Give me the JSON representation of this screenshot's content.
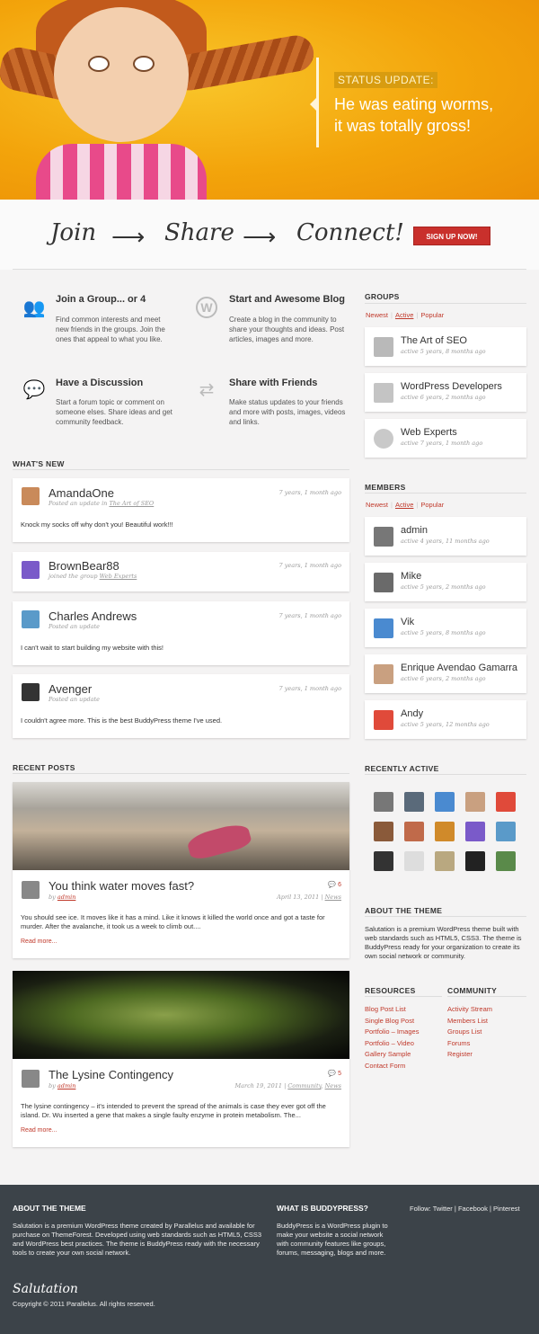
{
  "hero": {
    "status_tag": "STATUS UPDATE:",
    "status_line1": "He was eating worms,",
    "status_line2": "it was totally gross!"
  },
  "join": {
    "step1": "Join",
    "step2": "Share",
    "step3": "Connect!",
    "signup_label": "SIGN UP NOW!"
  },
  "features": [
    {
      "title": "Join a Group... or 4",
      "desc": "Find common interests and meet new friends in the groups. Join the ones that appeal to what you like."
    },
    {
      "title": "Start and Awesome Blog",
      "desc": "Create a blog in the community to share your thoughts and ideas. Post articles, images and more."
    },
    {
      "title": "Have a Discussion",
      "desc": "Start a forum topic or comment on someone elses. Share ideas and get community feedback."
    },
    {
      "title": "Share with Friends",
      "desc": "Make status updates to your friends and more with posts, images, videos and links."
    }
  ],
  "whats_new": {
    "title": "WHAT'S NEW",
    "items": [
      {
        "name": "AmandaOne",
        "time": "7 years, 1 month ago",
        "meta_prefix": "Posted an update in",
        "meta_link": "The Art of SEO",
        "text": "Knock my socks off why don't you! Beautiful work!!!"
      },
      {
        "name": "BrownBear88",
        "time": "7 years, 1 month ago",
        "meta_prefix": "joined the group",
        "meta_link": "Web Experts",
        "text": ""
      },
      {
        "name": "Charles Andrews",
        "time": "7 years, 1 month ago",
        "meta_prefix": "Posted an update",
        "meta_link": "",
        "text": "I can't wait to start building my website with this!"
      },
      {
        "name": "Avenger",
        "time": "7 years, 1 month ago",
        "meta_prefix": "Posted an update",
        "meta_link": "",
        "text": "I couldn't agree more. This is the best BuddyPress theme I've used."
      }
    ]
  },
  "recent_posts": {
    "title": "RECENT POSTS",
    "posts": [
      {
        "title": "You think water moves fast?",
        "by": "by",
        "author": "admin",
        "date": "April 13, 2011",
        "category": "News",
        "comments": "6",
        "excerpt": "You should see ice. It moves like it has a mind. Like it knows it killed the world once and got a taste for murder. After the avalanche, it took us a week to climb out....",
        "read_more": "Read more..."
      },
      {
        "title": "The Lysine Contingency",
        "by": "by",
        "author": "admin",
        "date": "March 19, 2011",
        "category1": "Community",
        "category2": "News",
        "comments": "5",
        "excerpt": "The lysine contingency – it's intended to prevent the spread of the animals is case they ever got off the island. Dr. Wu inserted a gene that makes a single faulty enzyme in protein metabolism. The...",
        "read_more": "Read more..."
      }
    ]
  },
  "groups": {
    "title": "GROUPS",
    "tabs": [
      "Newest",
      "Active",
      "Popular"
    ],
    "items": [
      {
        "name": "The Art of SEO",
        "meta": "active 5 years, 8 months ago"
      },
      {
        "name": "WordPress Developers",
        "meta": "active 6 years, 2 months ago"
      },
      {
        "name": "Web Experts",
        "meta": "active 7 years, 1 month ago"
      }
    ]
  },
  "members": {
    "title": "MEMBERS",
    "tabs": [
      "Newest",
      "Active",
      "Popular"
    ],
    "items": [
      {
        "name": "admin",
        "meta": "active 4 years, 11 months ago"
      },
      {
        "name": "Mike",
        "meta": "active 5 years, 2 months ago"
      },
      {
        "name": "Vik",
        "meta": "active 5 years, 8 months ago"
      },
      {
        "name": "Enrique Avendao Gamarra",
        "meta": "active 6 years, 2 months ago"
      },
      {
        "name": "Andy",
        "meta": "active 5 years, 12 months ago"
      }
    ]
  },
  "recently_active": {
    "title": "RECENTLY ACTIVE"
  },
  "about": {
    "title": "ABOUT THE THEME",
    "text": "Salutation is a premium WordPress theme built with web standards such as HTML5, CSS3. The theme is BuddyPress ready for your organization to create its own social network or community."
  },
  "resources": {
    "title": "RESOURCES",
    "links": [
      "Blog Post List",
      "Single Blog Post",
      "Portfolio – Images",
      "Portfolio – Video",
      "Gallery Sample",
      "Contact Form"
    ]
  },
  "community": {
    "title": "COMMUNITY",
    "links": [
      "Activity Stream",
      "Members List",
      "Groups List",
      "Forums",
      "Register"
    ]
  },
  "footer": {
    "about_title": "ABOUT THE THEME",
    "about_text": "Salutation is a premium WordPress theme created by Parallelus and available for purchase on ThemeForest. Developed using web standards such as HTML5, CSS3 and WordPress best practices. The theme is BuddyPress ready with the necessary tools to create your own social network.",
    "bp_title": "WHAT IS BUDDYPRESS?",
    "bp_text": "BuddyPress is a WordPress plugin to make your website a social network with community features like groups, forums, messaging, blogs and more.",
    "follow_prefix": "Follow:",
    "follow_links": [
      "Twitter",
      "Facebook",
      "Pinterest"
    ],
    "follow_sep": "|",
    "logo": "Salutation",
    "copyright": "Copyright © 2011 Parallelus. All rights reserved."
  },
  "colors": {
    "accent": "#c0392b",
    "hero": "#f3a40b",
    "footer": "#3c4349"
  }
}
